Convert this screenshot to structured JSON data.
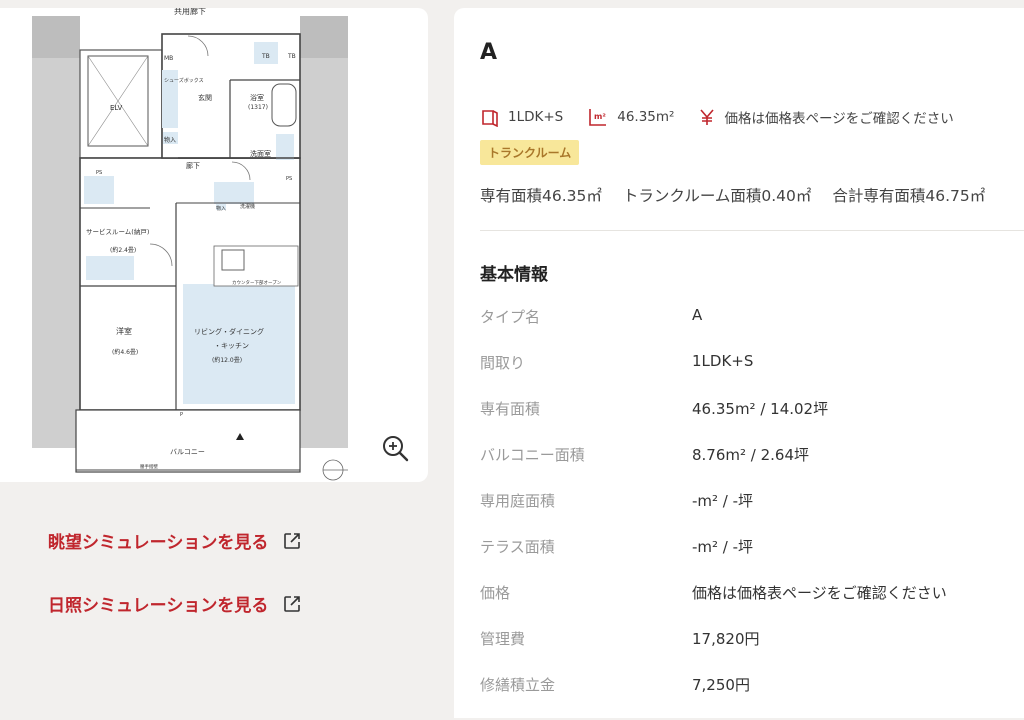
{
  "floorplan": {
    "labels": {
      "corridor": "共用廊下",
      "mb": "MB",
      "tb1": "TB",
      "tb2": "TB",
      "elv": "ELV",
      "shoes": "シューズボックス",
      "entrance": "玄関",
      "bath": "浴室",
      "bath_size": "(1317)",
      "storage1": "物入",
      "hallway": "廊下",
      "washroom": "洗面室",
      "washer": "洗濯機",
      "ps1": "PS",
      "ps2": "PS",
      "service_room": "サービスルーム(納戸)",
      "service_size": "(約2.4畳)",
      "storage2": "物入",
      "western_room": "洋室",
      "western_size": "(約4.6畳)",
      "counter": "カウンター下部オープン",
      "ldk": "リビング・ダイニング",
      "ldk2": "・キッチン",
      "ldk_size": "(約12.0畳)",
      "balcony": "バルコニー",
      "rail": "腰手摺壁",
      "p": "P"
    }
  },
  "zoom_icon": "zoom-in-icon",
  "links": {
    "view_sim": "眺望シミュレーションを見る",
    "sun_sim": "日照シミュレーションを見る"
  },
  "unit": {
    "type": "A",
    "layout": "1LDK+S",
    "area": "46.35m²",
    "price_note": "価格は価格表ページをご確認ください",
    "badge": "トランクルーム",
    "area_private": "専有面積46.35㎡",
    "area_trunk": "トランクルーム面積0.40㎡",
    "area_total": "合計専有面積46.75㎡"
  },
  "basic_info": {
    "title": "基本情報",
    "rows": [
      {
        "label": "タイプ名",
        "value": "A"
      },
      {
        "label": "間取り",
        "value": "1LDK+S"
      },
      {
        "label": "専有面積",
        "value": "46.35m² / 14.02坪"
      },
      {
        "label": "バルコニー面積",
        "value": "8.76m² / 2.64坪"
      },
      {
        "label": "専用庭面積",
        "value": "-m² / -坪"
      },
      {
        "label": "テラス面積",
        "value": "-m² / -坪"
      },
      {
        "label": "価格",
        "value": "価格は価格表ページをご確認ください"
      },
      {
        "label": "管理費",
        "value": "17,820円"
      },
      {
        "label": "修繕積立金",
        "value": "7,250円"
      }
    ]
  },
  "colors": {
    "accent": "#c0262d",
    "badge_bg": "#f8e79a",
    "badge_text": "#a9772a"
  }
}
